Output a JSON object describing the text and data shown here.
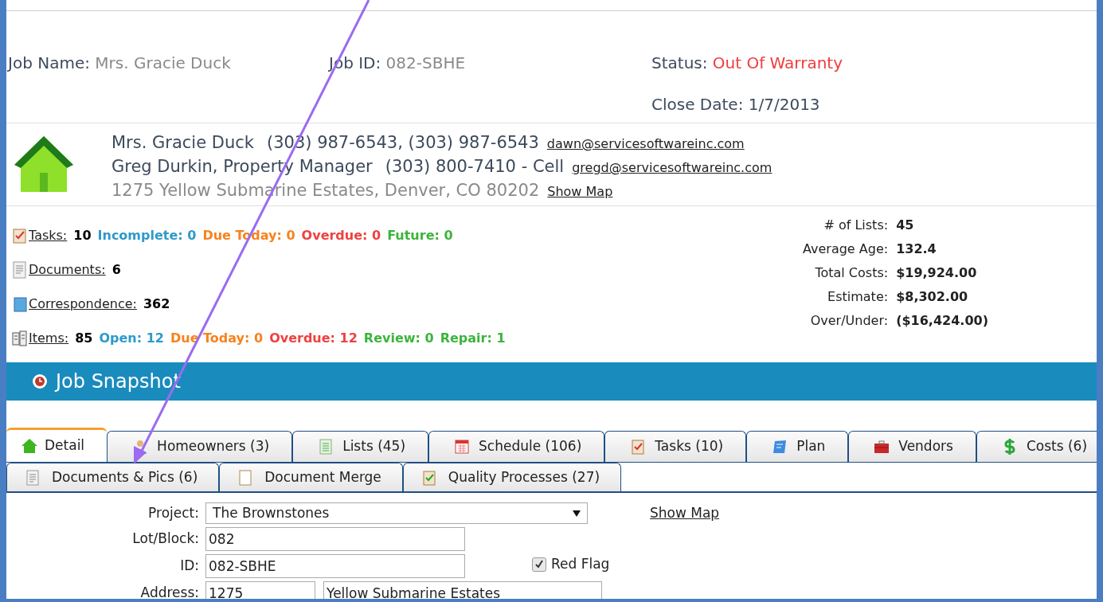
{
  "header": {
    "job_name_label": "Job Name:",
    "job_name": "Mrs. Gracie Duck",
    "job_id_label": "Job ID:",
    "job_id": "082-SBHE",
    "status_label": "Status:",
    "status": "Out Of Warranty",
    "close_date_label": "Close Date:",
    "close_date": "1/7/2013"
  },
  "contact": {
    "lines": [
      {
        "name": "Mrs. Gracie Duck",
        "phones": "(303) 987-6543, (303) 987-6543",
        "link": "dawn@servicesoftwareinc.com",
        "kind": "person"
      },
      {
        "name": "Greg Durkin, Property Manager",
        "phones": "(303) 800-7410 - Cell",
        "link": "gregd@servicesoftwareinc.com",
        "kind": "person"
      },
      {
        "name": "1275 Yellow Submarine Estates, Denver, CO 80202",
        "link": "Show Map",
        "kind": "address"
      }
    ]
  },
  "stats": [
    {
      "link": "Tasks:",
      "value": "10",
      "segments": [
        {
          "text": "Incomplete: 0",
          "color": "#2e9ac9"
        },
        {
          "text": "Due Today: 0",
          "color": "#f7821e"
        },
        {
          "text": "Overdue: 0",
          "color": "#f04040"
        },
        {
          "text": "Future: 0",
          "color": "#3cb43c"
        }
      ]
    },
    {
      "link": "Documents:",
      "value": "6"
    },
    {
      "link": "Correspondence:",
      "value": "362"
    },
    {
      "link": "Items:",
      "value": "85",
      "segments": [
        {
          "text": "Open: 12",
          "color": "#2e9ac9"
        },
        {
          "text": "Due Today: 0",
          "color": "#f7821e"
        },
        {
          "text": "Overdue: 12",
          "color": "#f04040"
        },
        {
          "text": "Review: 0",
          "color": "#3cb43c"
        },
        {
          "text": "Repair: 1",
          "color": "#3cb43c"
        }
      ]
    }
  ],
  "summary": [
    {
      "label": "# of Lists:",
      "value": "45"
    },
    {
      "label": "Average Age:",
      "value": "132.4"
    },
    {
      "label": "Total Costs:",
      "value": "$19,924.00"
    },
    {
      "label": "Estimate:",
      "value": "$8,302.00"
    },
    {
      "label": "Over/Under:",
      "value": "($16,424.00)"
    }
  ],
  "section_title": "Job Snapshot",
  "tabs": [
    {
      "label": "Detail",
      "selected": true
    },
    {
      "label": "Homeowners (3)",
      "selected": false
    },
    {
      "label": "Lists (45)",
      "selected": false
    },
    {
      "label": "Schedule (106)",
      "selected": false
    },
    {
      "label": "Tasks (10)",
      "selected": false
    },
    {
      "label": "Plan",
      "selected": false
    },
    {
      "label": "Vendors",
      "selected": false
    },
    {
      "label": "Costs (6)",
      "selected": false
    }
  ],
  "subtabs": [
    {
      "label": "Documents & Pics (6)",
      "selected": false
    },
    {
      "label": "Document Merge",
      "selected": false
    },
    {
      "label": "Quality Processes (27)",
      "selected": false
    }
  ],
  "form": {
    "project_label": "Project:",
    "project": "The Brownstones",
    "show_map": "Show Map",
    "lot_label": "Lot/Block:",
    "lot": "082",
    "id_label": "ID:",
    "id": "082-SBHE",
    "red_flag": {
      "label": "Red Flag",
      "checked": true
    },
    "address_label": "Address:",
    "address_number": "1275",
    "address_street": "Yellow Submarine Estates"
  }
}
